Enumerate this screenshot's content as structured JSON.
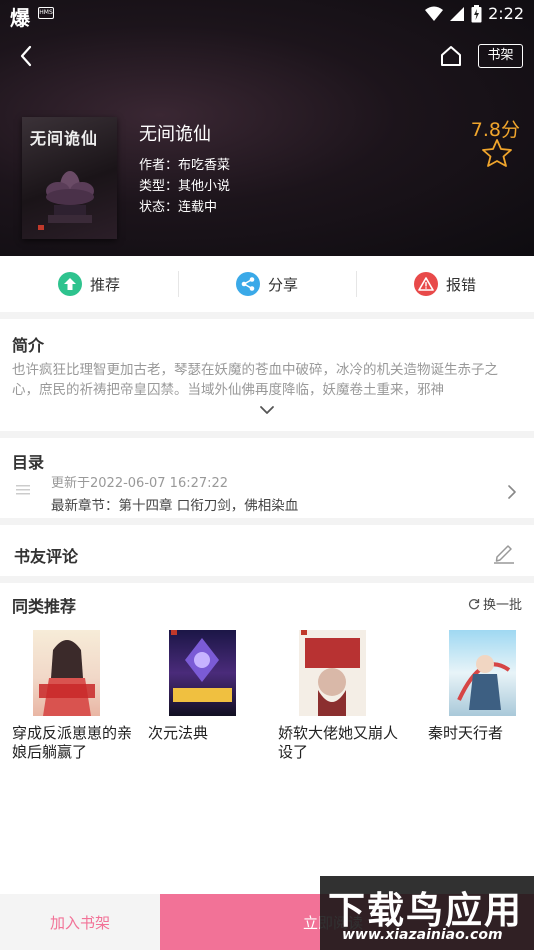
{
  "status_bar": {
    "app_glyph": "爆",
    "hms_badge": "HMS",
    "time": "2:22"
  },
  "header": {
    "shelf_label": "书架"
  },
  "book": {
    "cover_title": "无间诡仙",
    "title": "无间诡仙",
    "author": "作者：布吃香菜",
    "type": "类型：其他小说",
    "status": "状态：连载中",
    "score": "7.8分"
  },
  "actions": [
    {
      "label": "推荐",
      "color": "#2ec38e",
      "icon": "thumb-up-icon"
    },
    {
      "label": "分享",
      "color": "#3aa9e8",
      "icon": "share-icon"
    },
    {
      "label": "报错",
      "color": "#e84a4a",
      "icon": "warning-icon"
    }
  ],
  "intro": {
    "title": "简介",
    "text": "也许疯狂比理智更加古老，琴瑟在妖魔的苍血中破碎，冰冷的机关造物诞生赤子之心，庶民的祈祷把帝皇囚禁。当域外仙佛再度降临，妖魔卷土重来，邪神"
  },
  "catalog": {
    "title": "目录",
    "updated": "更新于2022-06-07 16:27:22",
    "latest": "最新章节：第十四章 口衔刀剑，佛相染血"
  },
  "comments": {
    "title": "书友评论"
  },
  "similar": {
    "title": "同类推荐",
    "refresh_label": "换一批",
    "items": [
      {
        "title": "穿成反派崽崽的亲娘后躺赢了"
      },
      {
        "title": "次元法典"
      },
      {
        "title": "娇软大佬她又崩人设了"
      },
      {
        "title": "秦时天行者"
      }
    ]
  },
  "bottom": {
    "add_label": "加入书架",
    "read_label": "立即阅读"
  },
  "watermark": {
    "title": "下载鸟应用",
    "url": "www.xiazainiao.com"
  },
  "colors": {
    "accent_pink": "#f27297",
    "score_gold": "#f0a52c"
  }
}
